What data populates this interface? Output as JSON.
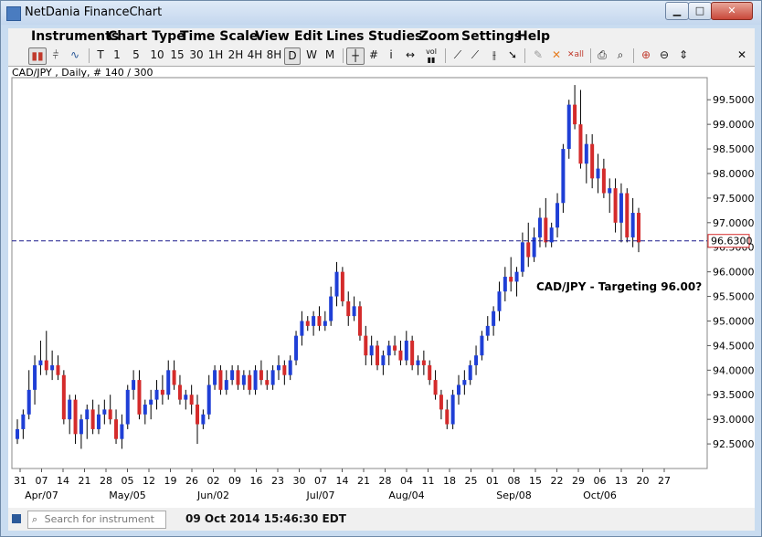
{
  "window": {
    "title": "NetDania FinanceChart"
  },
  "menu": [
    "Instruments",
    "Chart Type",
    "Time Scale",
    "View",
    "Edit",
    "Lines",
    "Studies",
    "Zoom",
    "Settings",
    "Help"
  ],
  "toolbar": {
    "timescales": [
      "T",
      "1",
      "5",
      "10",
      "15",
      "30",
      "1H",
      "2H",
      "4H",
      "8H",
      "D",
      "W",
      "M"
    ],
    "active_timescale": "D"
  },
  "chart_header": "CAD/JPY , Daily, # 140 / 300",
  "status": {
    "search_placeholder": "Search for instrument",
    "timestamp": "09 Oct 2014 15:46:30 EDT"
  },
  "chart_data": {
    "type": "candlestick",
    "symbol": "CAD/JPY",
    "ylim": [
      92.0,
      99.95
    ],
    "y_ticks": [
      92.5,
      93.0,
      93.5,
      94.0,
      94.5,
      95.0,
      95.5,
      96.0,
      96.5,
      97.0,
      97.5,
      98.0,
      98.5,
      99.0,
      99.5
    ],
    "tick_labels": [
      "31",
      "07",
      "14",
      "21",
      "28",
      "05",
      "12",
      "19",
      "26",
      "02",
      "09",
      "16",
      "23",
      "30",
      "07",
      "14",
      "21",
      "28",
      "04",
      "11",
      "18",
      "25",
      "01",
      "08",
      "15",
      "22",
      "29",
      "06",
      "13",
      "20",
      "27"
    ],
    "month_labels": [
      "Apr/07",
      "May/05",
      "Jun/02",
      "Jul/07",
      "Aug/04",
      "Sep/08",
      "Oct/06"
    ],
    "current_price": "96.6300",
    "annotation": "CAD/JPY - Targeting 96.00?",
    "up_color": "#1f3fd6",
    "down_color": "#d42b2b",
    "candles": [
      [
        92.6,
        93.0,
        92.5,
        92.8
      ],
      [
        92.8,
        93.2,
        92.6,
        93.1
      ],
      [
        93.1,
        94.0,
        93.0,
        93.6
      ],
      [
        93.6,
        94.3,
        93.3,
        94.1
      ],
      [
        94.1,
        94.6,
        93.9,
        94.2
      ],
      [
        94.2,
        94.8,
        93.9,
        94.0
      ],
      [
        94.0,
        94.4,
        93.8,
        94.1
      ],
      [
        94.1,
        94.3,
        93.8,
        93.9
      ],
      [
        93.9,
        94.0,
        92.9,
        93.0
      ],
      [
        93.0,
        93.5,
        92.7,
        93.4
      ],
      [
        93.4,
        93.5,
        92.5,
        92.7
      ],
      [
        92.7,
        93.1,
        92.4,
        93.0
      ],
      [
        93.0,
        93.3,
        92.6,
        93.2
      ],
      [
        93.2,
        93.4,
        92.7,
        92.8
      ],
      [
        92.8,
        93.3,
        92.7,
        93.1
      ],
      [
        93.1,
        93.4,
        92.9,
        93.2
      ],
      [
        93.2,
        93.5,
        92.9,
        93.0
      ],
      [
        93.0,
        93.2,
        92.5,
        92.6
      ],
      [
        92.6,
        93.1,
        92.4,
        92.9
      ],
      [
        92.9,
        93.7,
        92.8,
        93.6
      ],
      [
        93.6,
        94.0,
        93.4,
        93.8
      ],
      [
        93.8,
        94.0,
        93.0,
        93.1
      ],
      [
        93.1,
        93.4,
        92.9,
        93.3
      ],
      [
        93.3,
        93.6,
        93.0,
        93.4
      ],
      [
        93.4,
        93.8,
        93.2,
        93.6
      ],
      [
        93.6,
        93.9,
        93.3,
        93.5
      ],
      [
        93.5,
        94.2,
        93.4,
        94.0
      ],
      [
        94.0,
        94.2,
        93.6,
        93.7
      ],
      [
        93.7,
        93.9,
        93.3,
        93.4
      ],
      [
        93.4,
        93.6,
        93.2,
        93.5
      ],
      [
        93.5,
        93.7,
        93.1,
        93.3
      ],
      [
        93.3,
        93.5,
        92.5,
        92.9
      ],
      [
        92.9,
        93.2,
        92.8,
        93.1
      ],
      [
        93.1,
        93.9,
        93.0,
        93.7
      ],
      [
        93.7,
        94.1,
        93.6,
        94.0
      ],
      [
        94.0,
        94.1,
        93.5,
        93.6
      ],
      [
        93.6,
        94.0,
        93.5,
        93.8
      ],
      [
        93.8,
        94.1,
        93.7,
        94.0
      ],
      [
        94.0,
        94.1,
        93.6,
        93.7
      ],
      [
        93.7,
        94.0,
        93.6,
        93.9
      ],
      [
        93.9,
        94.0,
        93.5,
        93.6
      ],
      [
        93.6,
        94.1,
        93.5,
        94.0
      ],
      [
        94.0,
        94.2,
        93.7,
        93.8
      ],
      [
        93.8,
        94.0,
        93.6,
        93.7
      ],
      [
        93.7,
        94.1,
        93.6,
        94.0
      ],
      [
        94.0,
        94.3,
        93.8,
        94.1
      ],
      [
        94.1,
        94.2,
        93.7,
        93.9
      ],
      [
        93.9,
        94.3,
        93.8,
        94.2
      ],
      [
        94.2,
        94.8,
        94.1,
        94.7
      ],
      [
        94.7,
        95.2,
        94.5,
        95.0
      ],
      [
        95.0,
        95.1,
        94.8,
        94.9
      ],
      [
        94.9,
        95.2,
        94.7,
        95.1
      ],
      [
        95.1,
        95.3,
        94.8,
        94.9
      ],
      [
        94.9,
        95.2,
        94.8,
        95.0
      ],
      [
        95.0,
        95.7,
        94.9,
        95.5
      ],
      [
        95.5,
        96.2,
        95.3,
        96.0
      ],
      [
        96.0,
        96.1,
        95.3,
        95.4
      ],
      [
        95.4,
        95.6,
        94.9,
        95.1
      ],
      [
        95.1,
        95.5,
        95.0,
        95.3
      ],
      [
        95.3,
        95.4,
        94.6,
        94.7
      ],
      [
        94.7,
        94.9,
        94.1,
        94.3
      ],
      [
        94.3,
        94.7,
        94.1,
        94.5
      ],
      [
        94.5,
        94.6,
        94.0,
        94.1
      ],
      [
        94.1,
        94.4,
        93.9,
        94.3
      ],
      [
        94.3,
        94.6,
        94.1,
        94.5
      ],
      [
        94.5,
        94.7,
        94.3,
        94.4
      ],
      [
        94.4,
        94.6,
        94.1,
        94.2
      ],
      [
        94.2,
        94.8,
        94.1,
        94.6
      ],
      [
        94.6,
        94.7,
        94.0,
        94.1
      ],
      [
        94.1,
        94.3,
        93.9,
        94.2
      ],
      [
        94.2,
        94.4,
        93.9,
        94.1
      ],
      [
        94.1,
        94.2,
        93.7,
        93.8
      ],
      [
        93.8,
        94.0,
        93.4,
        93.5
      ],
      [
        93.5,
        93.6,
        93.0,
        93.2
      ],
      [
        93.2,
        93.4,
        92.8,
        92.9
      ],
      [
        92.9,
        93.6,
        92.8,
        93.5
      ],
      [
        93.5,
        93.9,
        93.3,
        93.7
      ],
      [
        93.7,
        94.0,
        93.5,
        93.8
      ],
      [
        93.8,
        94.2,
        93.7,
        94.1
      ],
      [
        94.1,
        94.5,
        93.9,
        94.3
      ],
      [
        94.3,
        94.8,
        94.2,
        94.7
      ],
      [
        94.7,
        95.1,
        94.6,
        94.9
      ],
      [
        94.9,
        95.3,
        94.7,
        95.2
      ],
      [
        95.2,
        95.8,
        95.0,
        95.6
      ],
      [
        95.6,
        96.1,
        95.4,
        95.9
      ],
      [
        95.9,
        96.3,
        95.6,
        95.8
      ],
      [
        95.8,
        96.1,
        95.5,
        96.0
      ],
      [
        96.0,
        96.8,
        95.9,
        96.6
      ],
      [
        96.6,
        97.0,
        96.1,
        96.3
      ],
      [
        96.3,
        96.9,
        96.2,
        96.7
      ],
      [
        96.7,
        97.3,
        96.5,
        97.1
      ],
      [
        97.1,
        97.5,
        96.5,
        96.6
      ],
      [
        96.6,
        97.0,
        96.5,
        96.9
      ],
      [
        96.9,
        97.6,
        96.7,
        97.4
      ],
      [
        97.4,
        98.6,
        97.2,
        98.5
      ],
      [
        98.5,
        99.5,
        98.3,
        99.4
      ],
      [
        99.4,
        99.8,
        98.9,
        99.0
      ],
      [
        99.0,
        99.7,
        98.1,
        98.2
      ],
      [
        98.2,
        98.8,
        97.8,
        98.6
      ],
      [
        98.6,
        98.8,
        97.7,
        97.9
      ],
      [
        97.9,
        98.4,
        97.6,
        98.1
      ],
      [
        98.1,
        98.3,
        97.5,
        97.6
      ],
      [
        97.6,
        97.9,
        97.2,
        97.7
      ],
      [
        97.7,
        97.9,
        96.8,
        97.0
      ],
      [
        97.0,
        97.8,
        96.6,
        97.6
      ],
      [
        97.6,
        97.7,
        96.6,
        96.7
      ],
      [
        96.7,
        97.5,
        96.5,
        97.2
      ],
      [
        97.2,
        97.3,
        96.4,
        96.6
      ]
    ]
  }
}
